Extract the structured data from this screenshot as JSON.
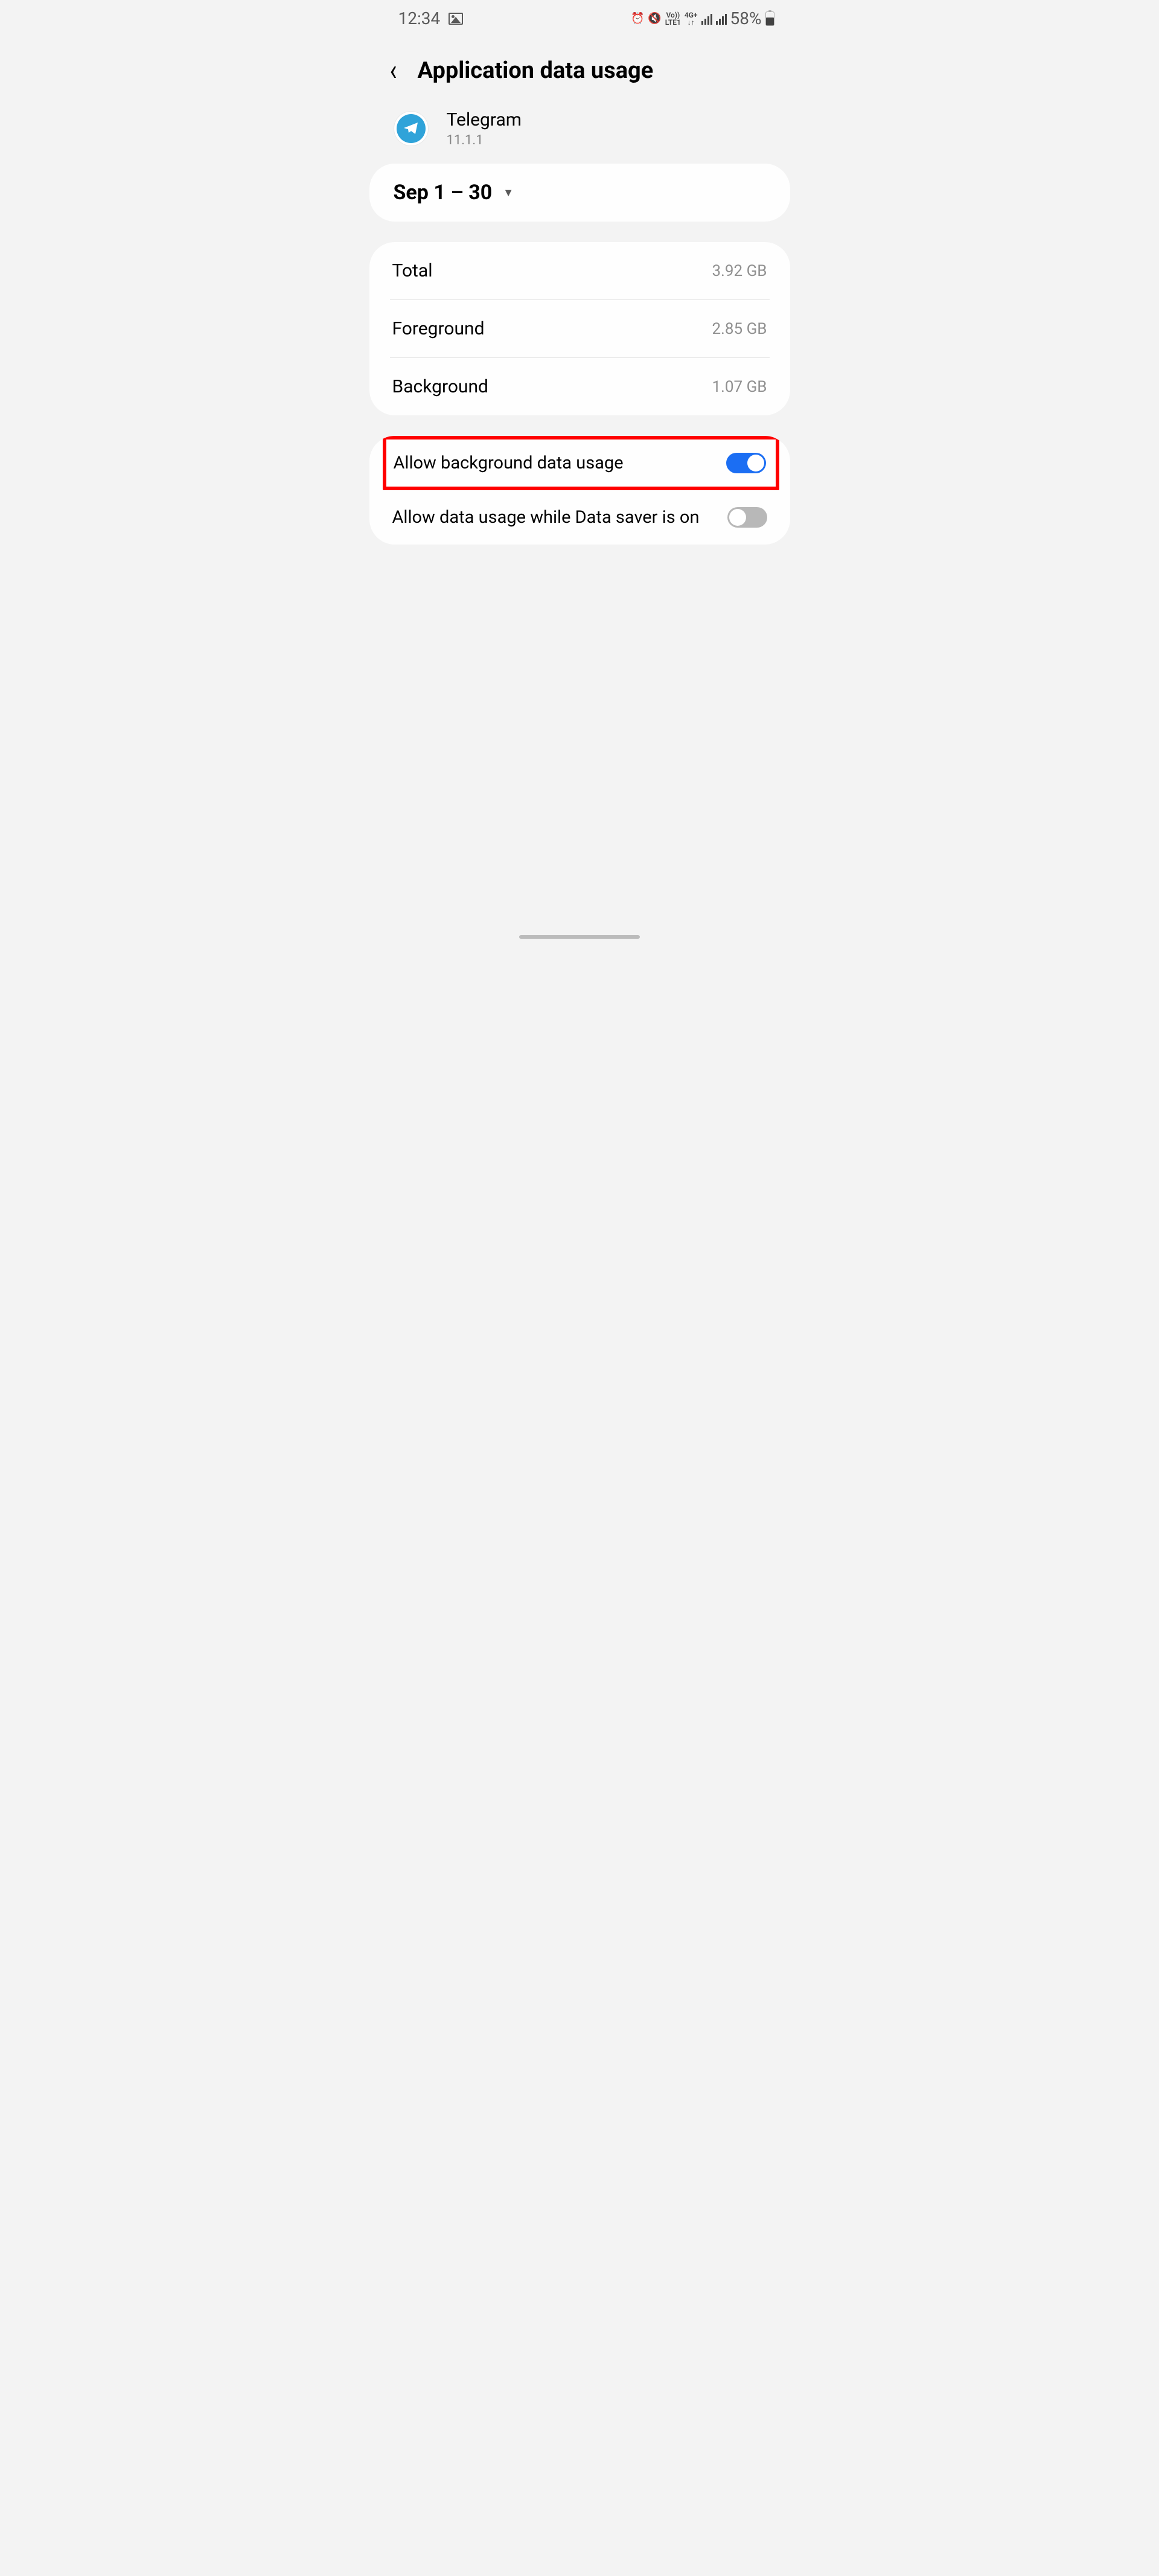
{
  "status": {
    "time": "12:34",
    "network1": "Vo))",
    "network1b": "LTE1",
    "network2": "4G+",
    "battery_text": "58%"
  },
  "header": {
    "title": "Application data usage"
  },
  "app": {
    "name": "Telegram",
    "version": "11.1.1"
  },
  "date_range": "Sep 1 – 30",
  "usage": {
    "total_label": "Total",
    "total_value": "3.92 GB",
    "foreground_label": "Foreground",
    "foreground_value": "2.85 GB",
    "background_label": "Background",
    "background_value": "1.07 GB"
  },
  "settings": {
    "bg_data_label": "Allow background data usage",
    "bg_data_on": true,
    "data_saver_label": "Allow data usage while Data saver is on",
    "data_saver_on": false
  }
}
